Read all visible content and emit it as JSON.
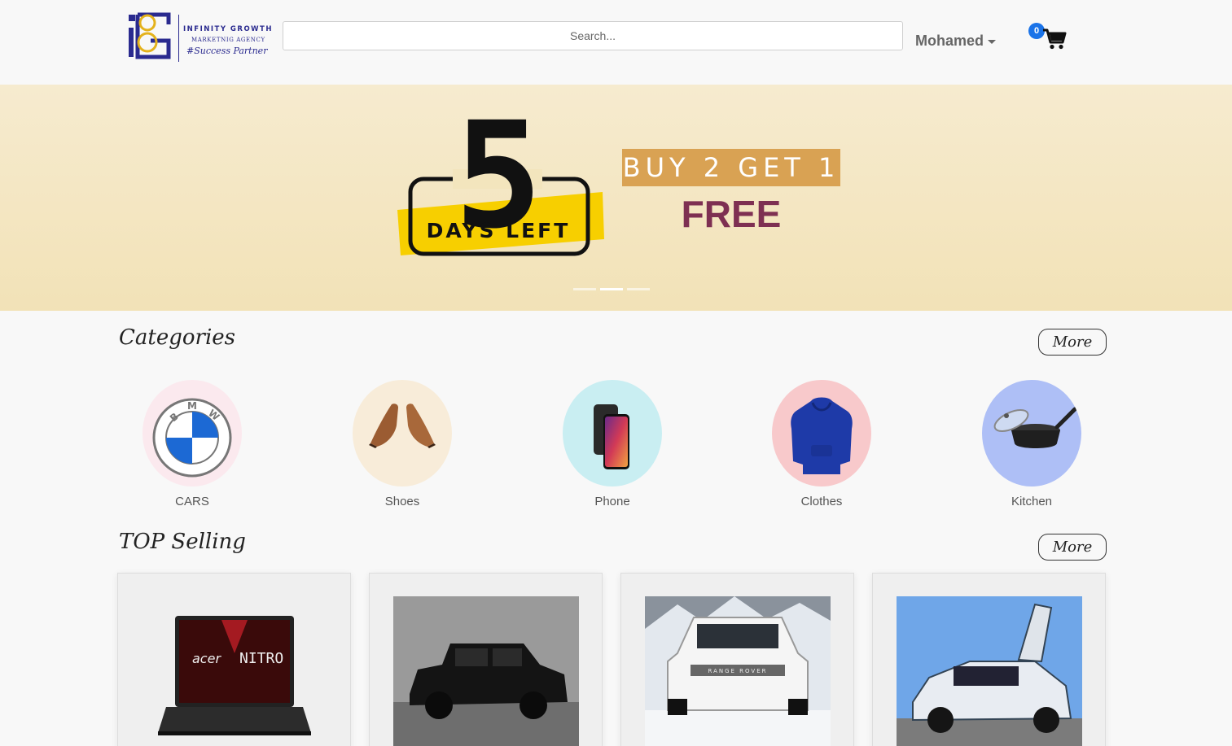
{
  "header": {
    "logo": {
      "line1": "INFINITY GROWTH",
      "line2": "MARKETNIG AGENCY",
      "line3": "#Success Partner"
    },
    "search": {
      "placeholder": "Search..."
    },
    "user": {
      "name": "Mohamed"
    },
    "cart": {
      "count": "0"
    }
  },
  "banner": {
    "countdown_number": "5",
    "countdown_text": "DAYS LEFT",
    "offer_line1": "BUY 2 GET 1",
    "offer_line2": "FREE",
    "slides": 3,
    "active_slide": 2
  },
  "categories": {
    "title": "Categories",
    "more_label": "More",
    "items": [
      {
        "label": "CARS",
        "icon": "bmw-logo-icon",
        "bg": "#fbe9ee"
      },
      {
        "label": "Shoes",
        "icon": "shoes-icon",
        "bg": "#f8ecd9"
      },
      {
        "label": "Phone",
        "icon": "phone-icon",
        "bg": "#c9eef2"
      },
      {
        "label": "Clothes",
        "icon": "hoodie-icon",
        "bg": "#f8c9cb"
      },
      {
        "label": "Kitchen",
        "icon": "pot-icon",
        "bg": "#aebff6"
      }
    ]
  },
  "top_selling": {
    "title": "TOP Selling",
    "more_label": "More",
    "products": [
      {
        "image": "laptop-image",
        "laptop_brand": "acer",
        "laptop_model": "NITRO"
      },
      {
        "image": "black-suv-image"
      },
      {
        "image": "white-range-rover-image",
        "car_badge": "RANGE ROVER"
      },
      {
        "image": "bmw-i8-image"
      }
    ]
  },
  "colors": {
    "accent_blue": "#1a73e8",
    "offer_box": "#d9a253",
    "offer_free": "#7e3052",
    "banner_bg": "#f3e5bd"
  }
}
